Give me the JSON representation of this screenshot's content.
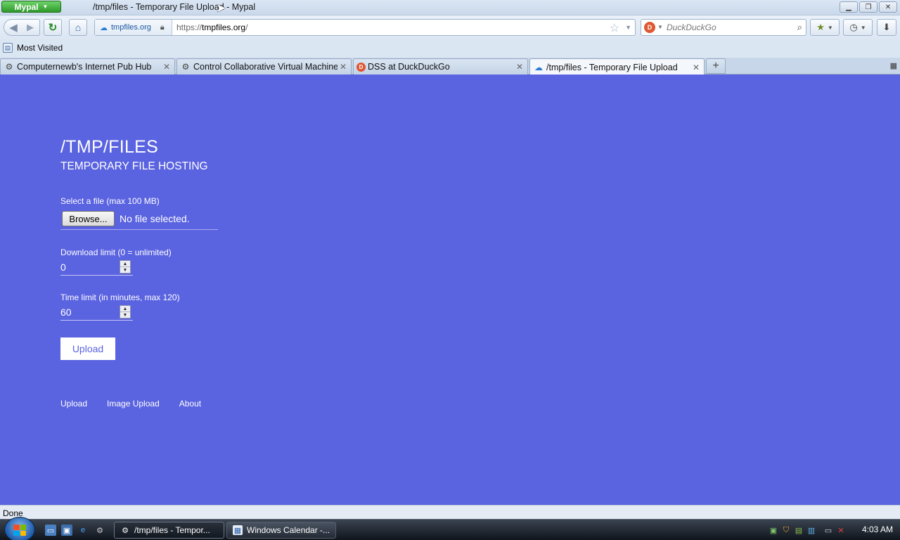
{
  "window": {
    "app_button": "Mypal",
    "title": "/tmp/files - Temporary File Upload - Mypal"
  },
  "navbar": {
    "site_identity": "tmpfiles.org",
    "url_scheme": "https://",
    "url_domain": "tmpfiles.org",
    "url_path": "/",
    "search_placeholder": "DuckDuckGo"
  },
  "bookmarks_bar": {
    "items": [
      {
        "label": "Most Visited",
        "icon": "bookmark-folder-icon"
      }
    ]
  },
  "tabs": [
    {
      "label": "Computernewb's Internet Pub Hub",
      "icon": "gear-icon",
      "active": false
    },
    {
      "label": "Control Collaborative Virtual Machines!",
      "icon": "gear-icon",
      "active": false
    },
    {
      "label": "DSS at DuckDuckGo",
      "icon": "duckduckgo-icon",
      "active": false
    },
    {
      "label": "/tmp/files - Temporary File Upload",
      "icon": "cloud-icon",
      "active": true
    }
  ],
  "page": {
    "title": "/TMP/FILES",
    "subtitle": "TEMPORARY FILE HOSTING",
    "file_label": "Select a file (max 100 MB)",
    "browse_label": "Browse...",
    "file_status": "No file selected.",
    "download_limit_label": "Download limit (0 = unlimited)",
    "download_limit_value": "0",
    "time_limit_label": "Time limit (in minutes, max 120)",
    "time_limit_value": "60",
    "upload_label": "Upload",
    "footer_links": [
      "Upload",
      "Image Upload",
      "About"
    ],
    "background_color": "#5a63e0"
  },
  "status_bar": {
    "text": "Done"
  },
  "taskbar": {
    "tasks": [
      {
        "label": "/tmp/files - Tempor...",
        "active": true
      },
      {
        "label": "Windows Calendar -...",
        "active": false
      }
    ],
    "clock": "4:03 AM"
  }
}
